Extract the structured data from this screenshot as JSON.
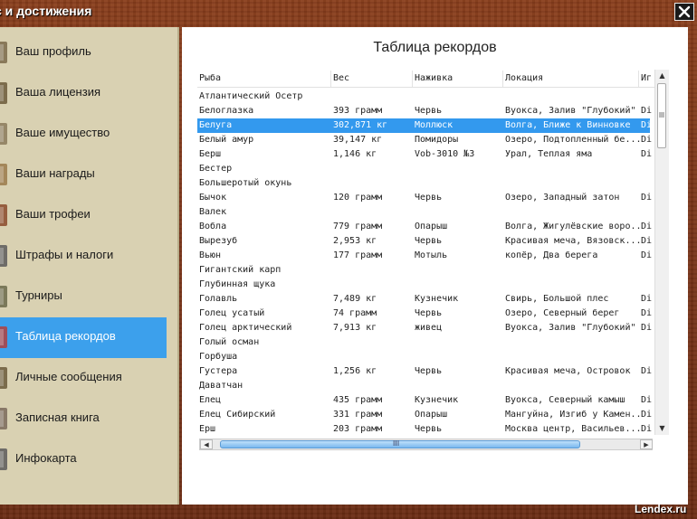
{
  "window": {
    "title": "с и достижения",
    "close_icon": "close-icon"
  },
  "sidebar": {
    "items": [
      {
        "label": "Ваш профиль",
        "icon": "profile-icon"
      },
      {
        "label": "Ваша лицензия",
        "icon": "license-icon"
      },
      {
        "label": "Ваше имущество",
        "icon": "property-icon"
      },
      {
        "label": "Ваши награды",
        "icon": "awards-icon"
      },
      {
        "label": "Ваши трофеи",
        "icon": "trophy-icon"
      },
      {
        "label": "Штрафы и налоги",
        "icon": "fines-icon"
      },
      {
        "label": "Турниры",
        "icon": "tournament-icon"
      },
      {
        "label": "Таблица рекордов",
        "icon": "records-icon",
        "active": true
      },
      {
        "label": "Личные сообщения",
        "icon": "messages-icon"
      },
      {
        "label": "Записная книга",
        "icon": "notebook-icon"
      },
      {
        "label": "Инфокарта",
        "icon": "infomap-icon"
      }
    ]
  },
  "main": {
    "title": "Таблица рекордов",
    "columns": [
      "Рыба",
      "Вес",
      "Наживка",
      "Локация",
      "Иг"
    ],
    "rows": [
      [
        "Атлантический Осетр",
        "",
        "",
        "",
        ""
      ],
      [
        "Белоглазка",
        "393 грамм",
        "Червь",
        "Вуокса, Залив \"Глубокий\"",
        "Di"
      ],
      [
        "Белуга",
        "302,871 кг",
        "Моллюск",
        "Волга, Ближе к Винновке",
        "Di"
      ],
      [
        "Белый амур",
        "39,147 кг",
        "Помидоры",
        "Озеро, Подтопленный бе...",
        "Di"
      ],
      [
        "Берш",
        "1,146 кг",
        "Vob-3010 №3",
        "Урал, Теплая яма",
        "Di"
      ],
      [
        "Бестер",
        "",
        "",
        "",
        ""
      ],
      [
        "Большеротый окунь",
        "",
        "",
        "",
        ""
      ],
      [
        "Бычок",
        "120 грамм",
        "Червь",
        "Озеро, Западный затон",
        "Di"
      ],
      [
        "Валек",
        "",
        "",
        "",
        ""
      ],
      [
        "Вобла",
        "779 грамм",
        "Опарыш",
        "Волга, Жигулёвские воро...",
        "Di"
      ],
      [
        "Вырезуб",
        "2,953 кг",
        "Червь",
        "Красивая меча, Вязовск...",
        "Di"
      ],
      [
        "Вьюн",
        "177 грамм",
        "Мотыль",
        "копёр, Два берега",
        "Di"
      ],
      [
        "Гигантский карп",
        "",
        "",
        "",
        ""
      ],
      [
        "Глубинная щука",
        "",
        "",
        "",
        ""
      ],
      [
        "Голавль",
        "7,489 кг",
        "Кузнечик",
        "Свирь, Большой плес",
        "Di"
      ],
      [
        "Голец усатый",
        "74 грамм",
        "Червь",
        "Озеро, Северный берег",
        "Di"
      ],
      [
        "Голец арктический",
        "7,913 кг",
        "живец",
        "Вуокса, Залив \"Глубокий\"",
        "Di"
      ],
      [
        "Голый осман",
        "",
        "",
        "",
        ""
      ],
      [
        "Горбуша",
        "",
        "",
        "",
        ""
      ],
      [
        "Густера",
        "1,256 кг",
        "Червь",
        "Красивая меча, Островок",
        "Di"
      ],
      [
        "Даватчан",
        "",
        "",
        "",
        ""
      ],
      [
        "Елец",
        "435 грамм",
        "Кузнечик",
        "Вуокса, Северный камыш",
        "Di"
      ],
      [
        "Елец Сибирский",
        "331 грамм",
        "Опарыш",
        "Мангуйна, Изгиб у Камен...",
        "Di"
      ],
      [
        "Ерш",
        "203 грамм",
        "Червь",
        "Москва центр, Васильев...",
        "Di"
      ]
    ],
    "selected_row": 2,
    "hscroll_thumb_glyph": "III"
  },
  "watermark": "Lendex.ru",
  "colors": {
    "accent": "#3ca0ec",
    "selected_row": "#3399ee",
    "sidebar_bg": "#d9d1b2",
    "wood": "#7a3418"
  }
}
